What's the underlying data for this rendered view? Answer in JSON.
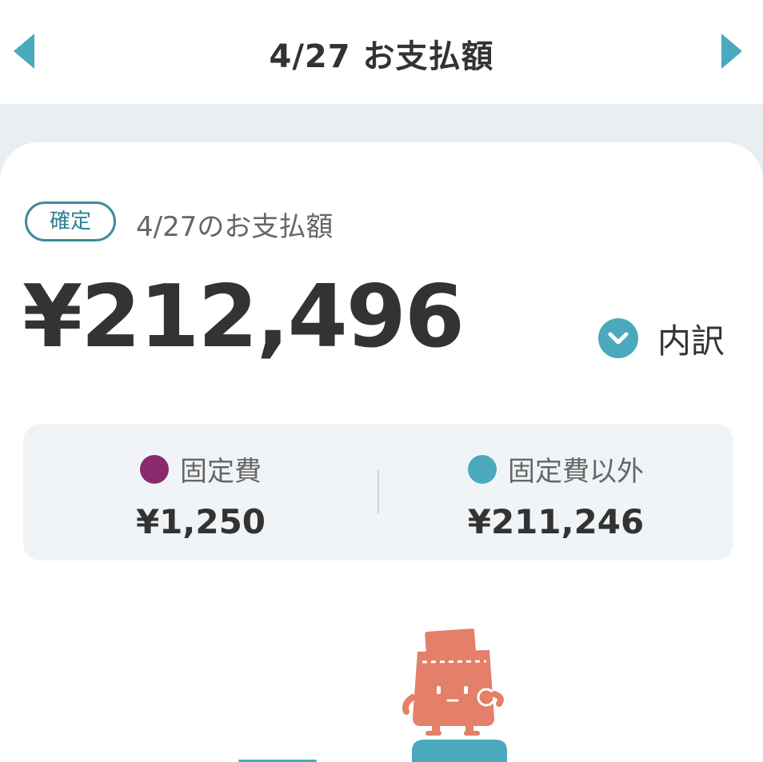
{
  "header": {
    "title": "4/27 お支払額",
    "prev_icon": "chevron-left-icon",
    "next_icon": "chevron-right-icon"
  },
  "payment": {
    "status_badge": "確定",
    "label": "4/27のお支払額",
    "total": "¥212,496",
    "breakdown_label": "内訳",
    "breakdown_icon": "chevron-down-circle-icon"
  },
  "summary": {
    "fixed": {
      "label": "固定費",
      "value": "¥1,250",
      "color": "#8a2a6e"
    },
    "variable": {
      "label": "固定費以外",
      "value": "¥211,246",
      "color": "#4aa9bd"
    }
  },
  "colors": {
    "accent": "#4aa9bd",
    "badge": "#3e8a9e",
    "mascot": "#e47f69"
  }
}
